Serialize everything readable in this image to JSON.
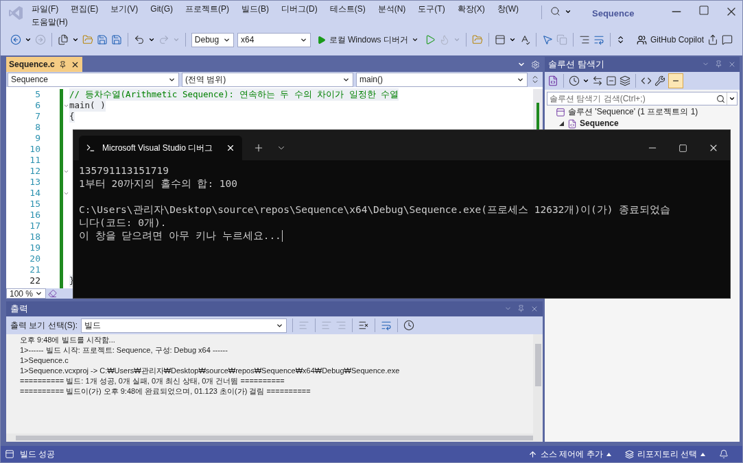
{
  "window": {
    "title": "Sequence"
  },
  "menu": [
    "파일(F)",
    "편집(E)",
    "보기(V)",
    "Git(G)",
    "프로젝트(P)",
    "빌드(B)",
    "디버그(D)",
    "테스트(S)",
    "분석(N)",
    "도구(T)",
    "확장(X)",
    "창(W)",
    "도움말(H)"
  ],
  "toolbar": {
    "configuration": "Debug",
    "platform": "x64",
    "run": "로컬 Windows 디버거",
    "copilot": "GitHub Copilot"
  },
  "editor": {
    "tabs": [
      {
        "label": "Sequence.c",
        "selected": true
      }
    ],
    "nav": [
      "Sequence",
      "(전역 범위)",
      "main()"
    ],
    "lines": [
      {
        "number": "5",
        "code": "// 등차수열(Arithmetic Sequence): 연속하는 두 수의 차이가 일정한 수열",
        "kind": "comment",
        "foldable": false,
        "current": false
      },
      {
        "number": "6",
        "code": "main( )",
        "kind": "code",
        "foldable": true,
        "current": false
      },
      {
        "number": "7",
        "code": "{",
        "kind": "code",
        "foldable": false,
        "current": false
      },
      {
        "number": "8",
        "foldable": false,
        "current": false
      },
      {
        "number": "9",
        "foldable": false,
        "current": false
      },
      {
        "number": "10",
        "foldable": false,
        "current": false
      },
      {
        "number": "11",
        "foldable": false,
        "current": false
      },
      {
        "number": "12",
        "foldable": true,
        "current": false
      },
      {
        "number": "13",
        "foldable": false,
        "current": false
      },
      {
        "number": "14",
        "foldable": true,
        "current": false
      },
      {
        "number": "15",
        "foldable": false,
        "current": false
      },
      {
        "number": "16",
        "foldable": false,
        "current": false
      },
      {
        "number": "17",
        "foldable": false,
        "current": false
      },
      {
        "number": "18",
        "foldable": false,
        "current": false
      },
      {
        "number": "19",
        "foldable": false,
        "current": false
      },
      {
        "number": "20",
        "foldable": false,
        "current": false
      },
      {
        "number": "21",
        "foldable": false,
        "current": false
      },
      {
        "number": "22",
        "code": "}",
        "kind": "code",
        "foldable": false,
        "current": true
      }
    ],
    "zoom": "100 %"
  },
  "console": {
    "title": "Microsoft Visual Studio 디버그",
    "blocks": [
      [
        "135791113151719",
        "1부터 20까지의 홀수의 합: 100"
      ],
      [
        "C:\\Users\\관리자\\Desktop\\source\\repos\\Sequence\\x64\\Debug\\Sequence.exe(프로세스 12632개)이(가) 종료되었습",
        "니다(코드: 0개).",
        "이 창을 닫으려면 아무 키나 누르세요..."
      ]
    ]
  },
  "output": {
    "title": "출력",
    "source_label": "출력 보기 선택(S):",
    "source": "빌드",
    "lines": [
      "오후 9:48에 빌드를 시작함...",
      "1>------ 빌드 시작: 프로젝트: Sequence, 구성: Debug x64 ------",
      "1>Sequence.c",
      "1>Sequence.vcxproj -> C:₩Users₩관리자₩Desktop₩source₩repos₩Sequence₩x64₩Debug₩Sequence.exe",
      "========== 빌드: 1개 성공, 0개 실패, 0개 최신 상태, 0개 건너뜀 ==========",
      "========== 빌드이(가) 오후 9:48에 완료되었으며, 01.123 초이(가) 걸림 =========="
    ]
  },
  "solution_explorer": {
    "title": "솔루션 탐색기",
    "search_placeholder": "솔루션 탐색기 검색(Ctrl+;)",
    "tree": [
      {
        "label": "솔루션 'Sequence' (1 프로젝트의 1)",
        "kind": "solution",
        "children": [
          {
            "label": "Sequence",
            "kind": "project",
            "expanded": true
          }
        ]
      }
    ]
  },
  "status_bar": {
    "status": "빌드 성공",
    "items": [
      "소스 제어에 추가",
      "리포지토리 선택"
    ]
  }
}
